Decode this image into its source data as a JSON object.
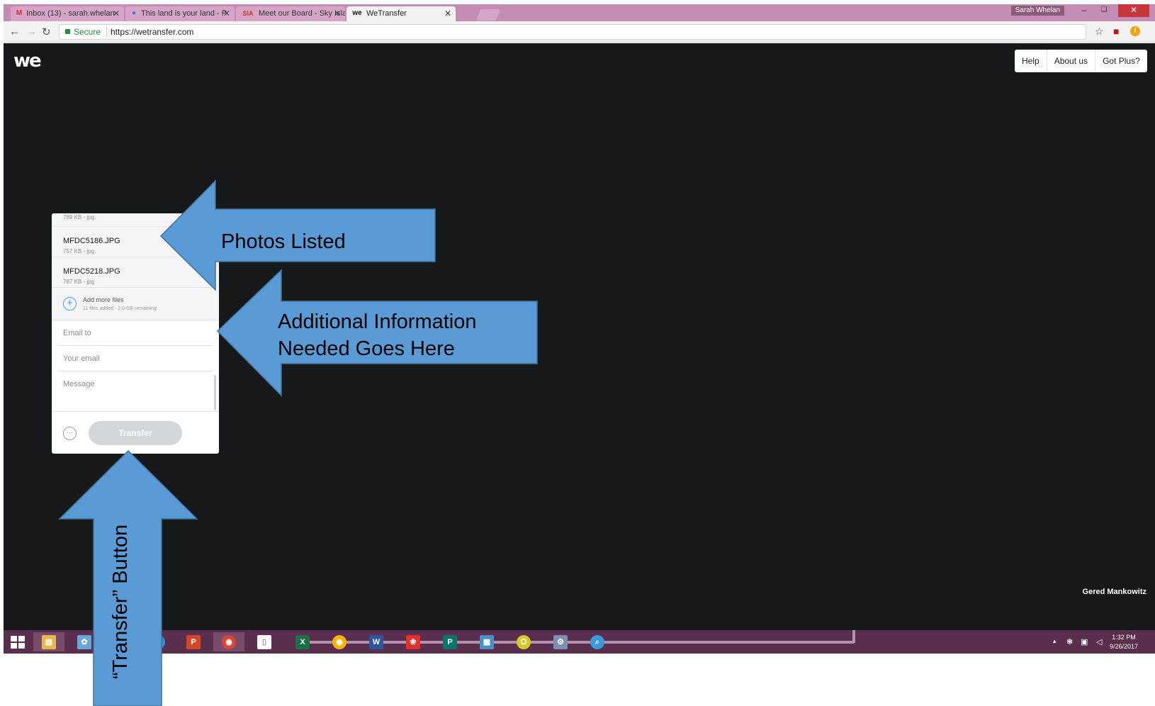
{
  "browser": {
    "tabs": [
      {
        "label": "Inbox (13) - sarah.whelan",
        "favicon": "M",
        "favicon_color": "#d93025"
      },
      {
        "label": "This land is your land - P",
        "favicon": "●",
        "favicon_color": "#3a7fc9"
      },
      {
        "label": "Meet our Board - Sky Isla",
        "favicon": "SIA",
        "favicon_color": "#c0392b"
      },
      {
        "label": "WeTransfer",
        "favicon": "we",
        "favicon_color": "#111111"
      }
    ],
    "close_glyph": "✕",
    "profile_name": "Sarah Whelan",
    "window_controls": {
      "minimize": "–",
      "restore": "❏",
      "close": "✕"
    },
    "nav": {
      "back": "←",
      "forward": "→",
      "reload": "↻"
    },
    "secure_label": "Secure",
    "url": "https://wetransfer.com",
    "icons": {
      "star": "☆",
      "pdf": "■",
      "alert": "!"
    }
  },
  "page": {
    "logo": "we",
    "nav": [
      "Help",
      "About us",
      "Got Plus?"
    ],
    "credit": "Gered Mankowitz"
  },
  "panel": {
    "files": [
      {
        "name": "",
        "meta": "789 KB - jpg"
      },
      {
        "name": "MFDC5186.JPG",
        "meta": "757 KB - jpg"
      },
      {
        "name": "MFDC5218.JPG",
        "meta": "787 KB - jpg"
      }
    ],
    "add_more_label": "Add more files",
    "add_more_meta": "11 files added - 2.0 GB remaining",
    "plus_glyph": "+",
    "email_to_placeholder": "Email to",
    "your_email_placeholder": "Your email",
    "message_placeholder": "Message",
    "more_glyph": "···",
    "transfer_label": "Transfer"
  },
  "annotations": {
    "photos": "Photos Listed",
    "info_line1": "Additional Information",
    "info_line2": "Needed Goes Here",
    "transfer": "“Transfer” Button",
    "arrow_color": "#5b9bd5",
    "arrow_border": "#41719c"
  },
  "taskbar": {
    "apps": [
      {
        "name": "file-explorer",
        "glyph": "▤",
        "color": "#e8b84a"
      },
      {
        "name": "paint",
        "glyph": "✿",
        "color": "#6aa7d8"
      },
      {
        "name": "internet-explorer",
        "glyph": "e",
        "color": "#2d8fd5"
      },
      {
        "name": "powerpoint",
        "glyph": "P",
        "color": "#d24726"
      },
      {
        "name": "chrome",
        "glyph": "◉",
        "color": "#db4437"
      },
      {
        "name": "blank-document",
        "glyph": "▯",
        "color": "#ffffff"
      },
      {
        "name": "excel",
        "glyph": "X",
        "color": "#1d7044"
      },
      {
        "name": "chrome-2",
        "glyph": "◉",
        "color": "#f4b400"
      },
      {
        "name": "word",
        "glyph": "W",
        "color": "#2b579a"
      },
      {
        "name": "paint-alt",
        "glyph": "❀",
        "color": "#e0312c"
      },
      {
        "name": "publisher",
        "glyph": "P",
        "color": "#077568"
      },
      {
        "name": "calculator",
        "glyph": "▦",
        "color": "#4a90c8"
      },
      {
        "name": "app-yellow",
        "glyph": "⭘",
        "color": "#d8c82a"
      },
      {
        "name": "app-gear",
        "glyph": "⚙",
        "color": "#7f8fb0"
      },
      {
        "name": "search-app",
        "glyph": "⌕",
        "color": "#3b9bd8"
      }
    ],
    "tray_icons": [
      "▴",
      "❃",
      "▣",
      "◁"
    ],
    "time": "1:32 PM",
    "date": "9/26/2017"
  }
}
